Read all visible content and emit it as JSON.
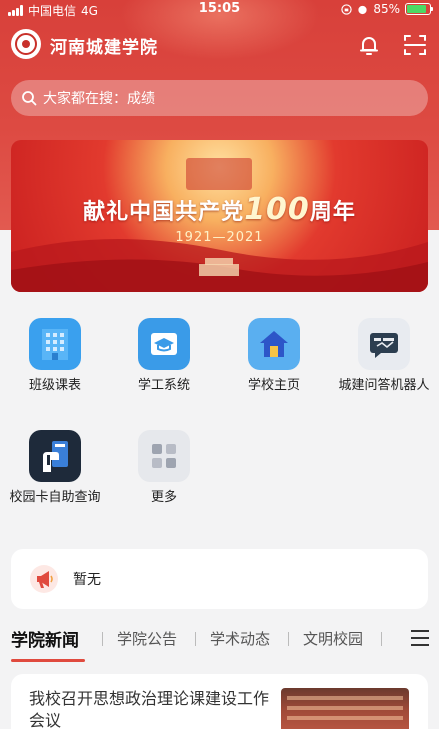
{
  "status_bar": {
    "carrier": "中国电信",
    "network": "4G",
    "time": "15:05",
    "battery": "85%",
    "battery_level": 0.85
  },
  "header": {
    "title": "河南城建学院",
    "bell_icon": "bell-icon",
    "scan_icon": "scan-icon"
  },
  "search": {
    "placeholder": "大家都在搜：成绩"
  },
  "banner": {
    "title_prefix": "献礼中国共产党",
    "title_number": "100",
    "title_suffix": "周年",
    "years": "1921—2021"
  },
  "quick_links": [
    {
      "label": "班级课表",
      "icon": "building-icon",
      "color": "#3aa0ee"
    },
    {
      "label": "学工系统",
      "icon": "graduation-cap-icon",
      "color": "#3a9be8"
    },
    {
      "label": "学校主页",
      "icon": "home-icon",
      "color": "#5aaff0"
    },
    {
      "label": "城建问答机器人",
      "icon": "chat-robot-icon",
      "color": "#e8ebf0"
    },
    {
      "label": "校园卡自助查询",
      "icon": "card-hand-icon",
      "color": "#1e2a3a"
    },
    {
      "label": "更多",
      "icon": "grid-more-icon",
      "color": "#e6e8ec"
    }
  ],
  "notice": {
    "icon": "megaphone-icon",
    "text": "暂无"
  },
  "news_tabs": {
    "items": [
      "学院新闻",
      "学院公告",
      "学术动态",
      "文明校园"
    ],
    "active_index": 0,
    "menu_icon": "menu-icon"
  },
  "news": {
    "title": "我校召开思想政治理论课建设工作会议"
  },
  "colors": {
    "primary_red": "#d8403a",
    "tab_underline": "#e04a3e"
  }
}
